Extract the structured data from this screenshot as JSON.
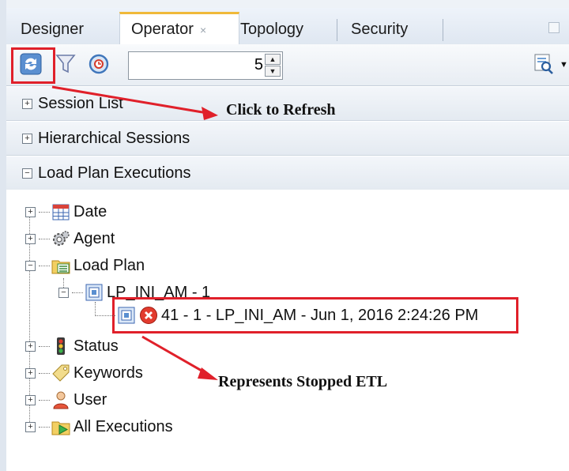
{
  "tabs": [
    {
      "label": "Designer"
    },
    {
      "label": "Operator",
      "active": true,
      "close": "×"
    },
    {
      "label": "Topology"
    },
    {
      "label": "Security"
    }
  ],
  "toolbar": {
    "refresh_icon": "refresh-icon",
    "filter_icon": "filter-icon",
    "auto_refresh_icon": "auto-refresh-icon",
    "interval_value": "5",
    "search_icon": "search-icon"
  },
  "sections": [
    {
      "label": "Session List",
      "toggle": "+"
    },
    {
      "label": "Hierarchical Sessions",
      "toggle": "+"
    },
    {
      "label": "Load Plan Executions",
      "toggle": "−"
    }
  ],
  "tree": {
    "date": "Date",
    "agent": "Agent",
    "load_plan": "Load Plan",
    "lp_child": "LP_INI_AM - 1",
    "run": "41 - 1 - LP_INI_AM - Jun 1, 2016 2:24:26 PM",
    "status": "Status",
    "keywords": "Keywords",
    "user": "User",
    "all_exec": "All Executions"
  },
  "annotations": {
    "refresh": "Click to Refresh",
    "stopped": "Represents Stopped ETL"
  },
  "colors": {
    "highlight": "#e0202a",
    "active_tab_accent": "#f0b93a"
  }
}
